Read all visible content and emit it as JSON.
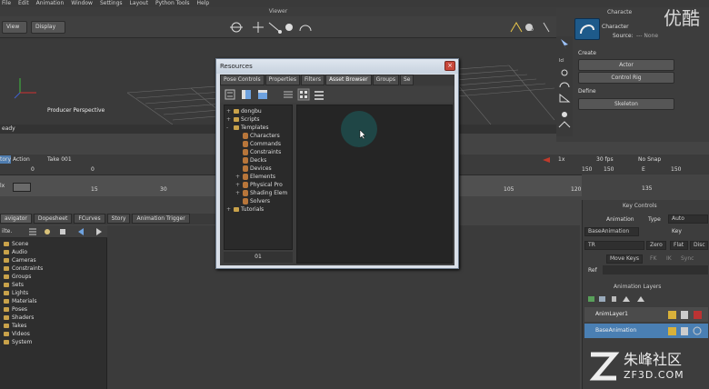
{
  "menu": [
    "File",
    "Edit",
    "Animation",
    "Window",
    "Settings",
    "Layout",
    "Python Tools",
    "Help"
  ],
  "viewer": {
    "title": "Viewer",
    "view_btn": "View",
    "display_btn": "Display",
    "perspective_label": "Producer Perspective",
    "status": "eady",
    "badge_2d": "2D"
  },
  "character_panel": {
    "title": "Characte",
    "character_label": "Character",
    "source_label": "Source:",
    "source_value": "--- None",
    "create_label": "Create",
    "actor_btn": "Actor",
    "control_rig_btn": "Control Rig",
    "define_label": "Define",
    "skeleton_btn": "Skeleton"
  },
  "transport": {
    "story_tab": "tory",
    "action_tab": "Action",
    "take": "Take 001",
    "start_value": "0",
    "current_value": "0",
    "fps": "30 fps",
    "snap": "No Snap",
    "end_a": "150",
    "end_b": "150",
    "e_label": "E",
    "playback_speed": "1x",
    "total": "150"
  },
  "ruler_labels": [
    "15",
    "30",
    "105",
    "120",
    "135"
  ],
  "ruler_start": "lx",
  "nav": {
    "tabs": [
      "avigator",
      "Dopesheet",
      "FCurves",
      "Story",
      "Animation Trigger"
    ],
    "filter": "ilte.",
    "items": [
      "Scene",
      "Audio",
      "Cameras",
      "Constraints",
      "Groups",
      "Sets",
      "Lights",
      "Materials",
      "Poses",
      "Shaders",
      "Takes",
      "Videos",
      "System"
    ]
  },
  "resources": {
    "title": "Resources",
    "close_glyph": "×",
    "tabs": [
      "Pose Controls",
      "Properties",
      "Filters",
      "Asset Browser",
      "Groups",
      "Se"
    ],
    "active_tab": "Asset Browser",
    "tree": [
      {
        "label": "dongbu",
        "depth": 0,
        "type": "folder",
        "expander": "+"
      },
      {
        "label": "Scripts",
        "depth": 0,
        "type": "folder",
        "expander": "+"
      },
      {
        "label": "Templates",
        "depth": 0,
        "type": "folder",
        "expander": "-"
      },
      {
        "label": "Characters",
        "depth": 1,
        "type": "figure",
        "expander": ""
      },
      {
        "label": "Commands",
        "depth": 1,
        "type": "figure",
        "expander": ""
      },
      {
        "label": "Constraints",
        "depth": 1,
        "type": "figure",
        "expander": ""
      },
      {
        "label": "Decks",
        "depth": 1,
        "type": "figure",
        "expander": ""
      },
      {
        "label": "Devices",
        "depth": 1,
        "type": "figure",
        "expander": ""
      },
      {
        "label": "Elements",
        "depth": 1,
        "type": "figure",
        "expander": "+"
      },
      {
        "label": "Physical Pro",
        "depth": 1,
        "type": "figure",
        "expander": "+"
      },
      {
        "label": "Shading Elem",
        "depth": 1,
        "type": "figure",
        "expander": "+"
      },
      {
        "label": "Solvers",
        "depth": 1,
        "type": "figure",
        "expander": ""
      },
      {
        "label": "Tutorials",
        "depth": 0,
        "type": "folder",
        "expander": "+"
      }
    ],
    "status": "01"
  },
  "key_controls": {
    "title": "Key Controls",
    "animation_label": "Animation",
    "type_label": "Type",
    "type_value": "Auto",
    "base_anim": "BaseAnimation",
    "key_btn": "Key",
    "tr": "TR",
    "zero": "Zero",
    "flat": "Flat",
    "disc": "Disc",
    "move_keys": "Move Keys",
    "fk": "FK",
    "ik": "IK",
    "sync": "Sync",
    "ref": "Ref"
  },
  "anim_layers": {
    "title": "Animation Layers",
    "layers": [
      {
        "name": "AnimLayer1",
        "selected": false
      },
      {
        "name": "BaseAnimation",
        "selected": true
      }
    ]
  },
  "watermark": {
    "top": "优酷",
    "brand": "朱峰社区",
    "url": "ZF3D.COM"
  },
  "colors": {
    "accent_blue": "#3d6e9e",
    "selected_layer": "#4a7fb3",
    "dialog_frame": "#d9dfe8",
    "play_red": "#c03a2b"
  }
}
